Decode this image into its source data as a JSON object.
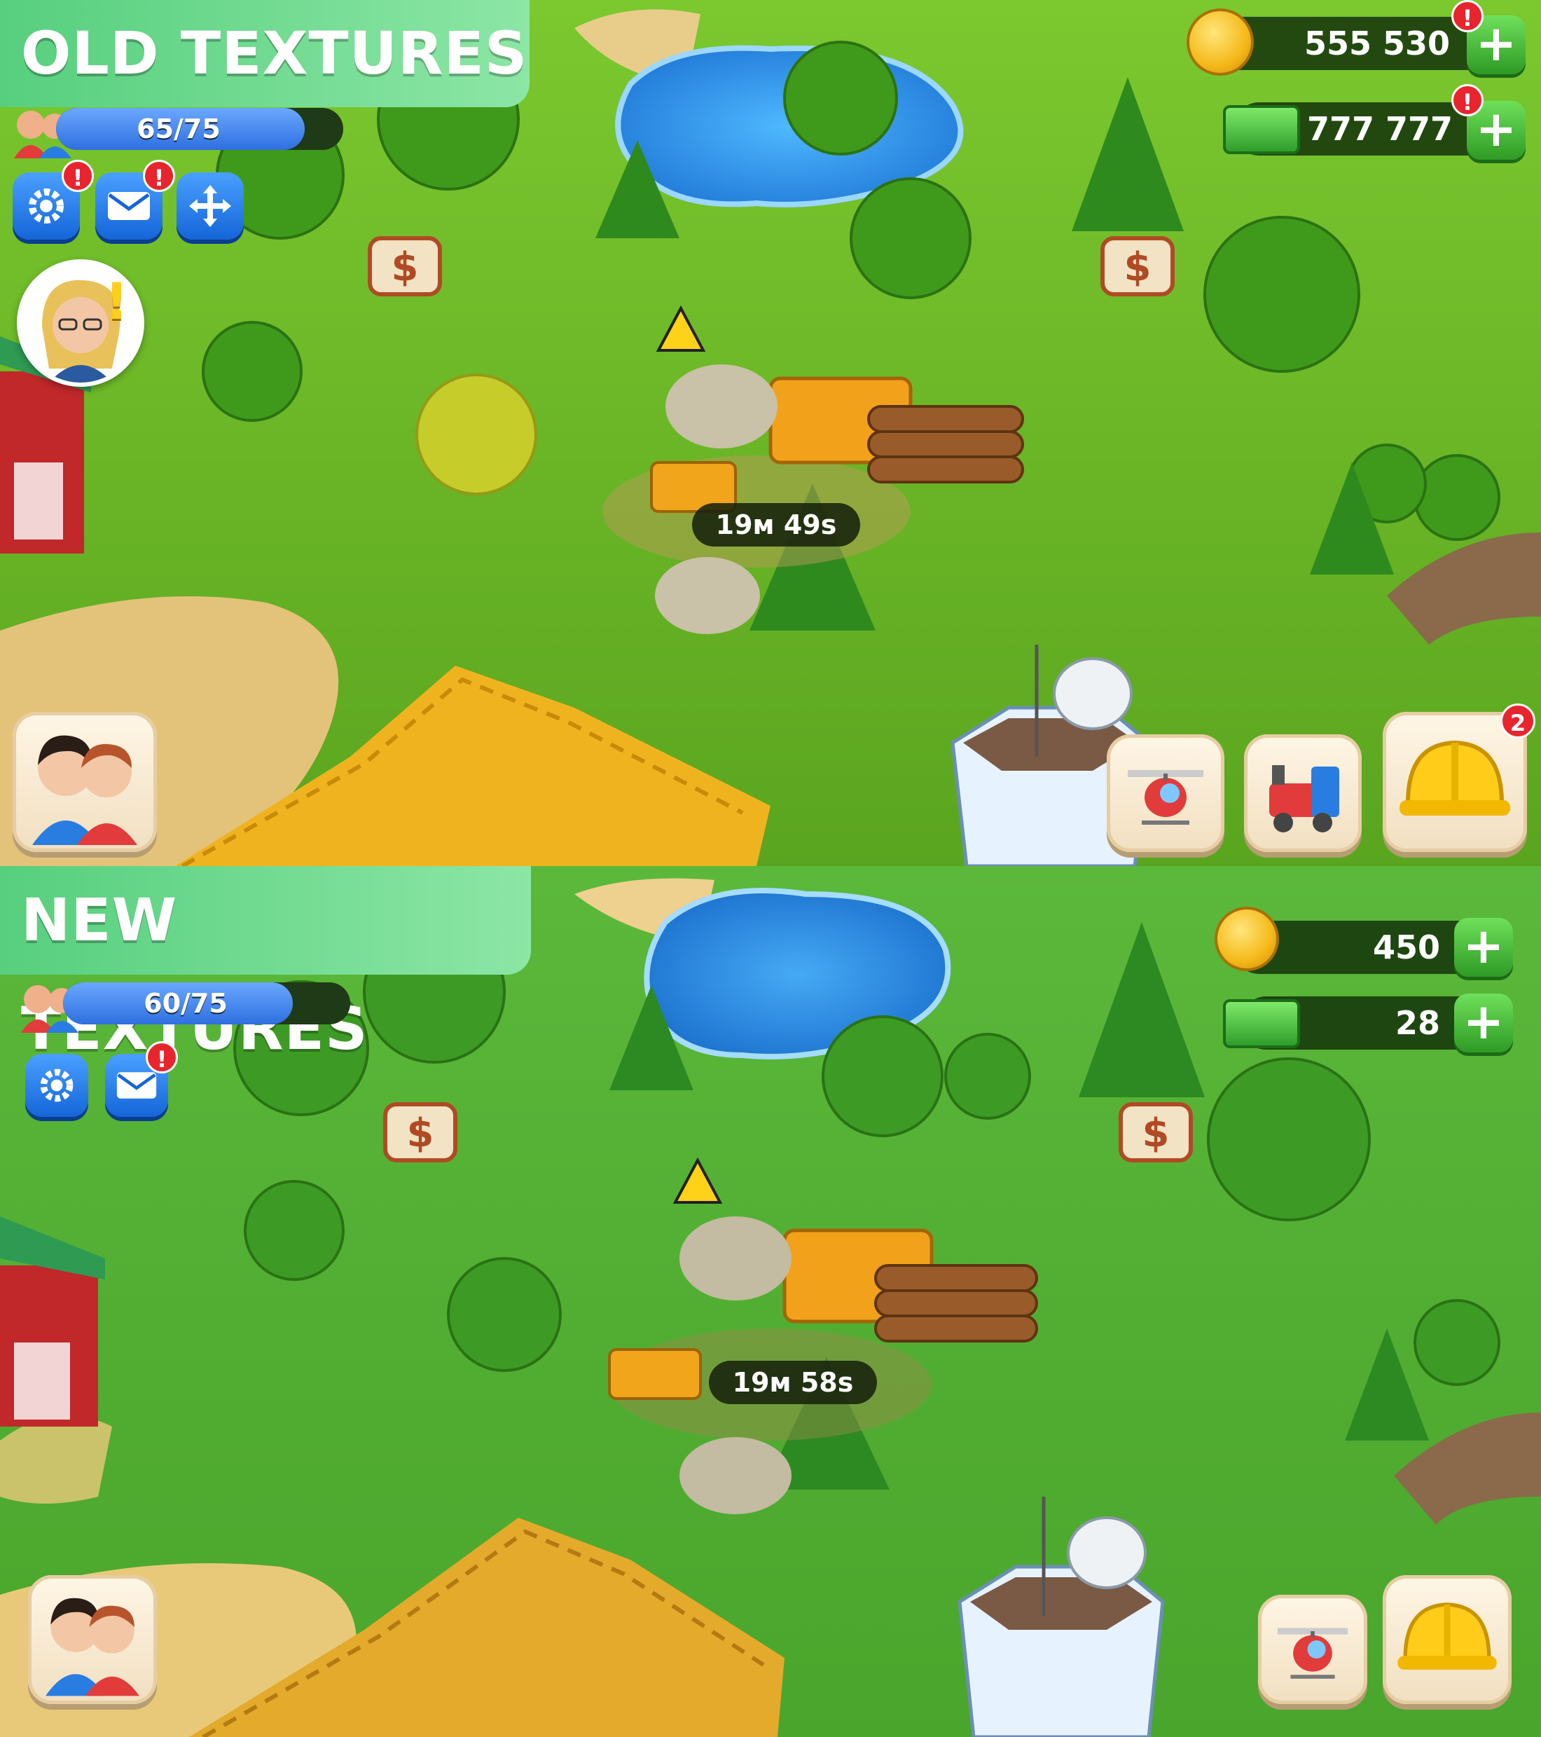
{
  "old": {
    "banner": "OLD TEXTURES",
    "xp": {
      "label": "65/75",
      "fraction": 0.8667
    },
    "coins": "555 530",
    "cash": "777 777",
    "timer": "19м 49s",
    "tools": {
      "settings_badge": "!",
      "mail_badge": "!",
      "coins_badge": "!",
      "cash_badge": "!"
    },
    "advisor_alert": "!",
    "toolbar_badge": "2"
  },
  "new": {
    "banner": "NEW TEXTURES",
    "xp": {
      "label": "60/75",
      "fraction": 0.8
    },
    "coins": "450",
    "cash": "28",
    "timer": "19м 58s",
    "tools": {
      "mail_badge": "!"
    }
  },
  "colors": {
    "banner_green": "#6bd98c",
    "button_blue": "#1e7bf0",
    "plus_green": "#36b02b",
    "grass_old": "#6fbf2a",
    "grass_new": "#4fae32"
  },
  "icons": [
    "settings-icon",
    "mail-icon",
    "move-icon",
    "coin-icon",
    "cash-icon",
    "plus-icon",
    "neighbors-icon",
    "helicopter-icon",
    "train-icon",
    "hardhat-icon",
    "dollar-sign-icon"
  ]
}
